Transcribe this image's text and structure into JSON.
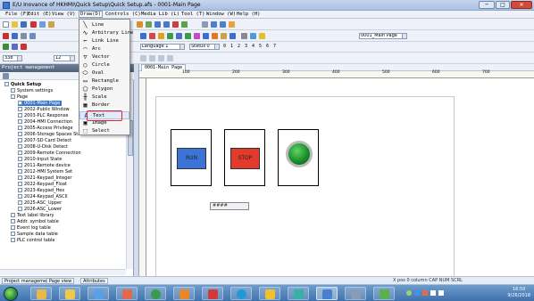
{
  "window": {
    "title": "E/U Inovance of HKHMI\\Quick Setup\\Quick Setup.afs - 0001-Main Page"
  },
  "window_buttons": {
    "minimize": "─",
    "maximize": "□",
    "close": "✕"
  },
  "menubar": [
    {
      "label": "File (F)",
      "key": "file"
    },
    {
      "label": "Edit (E)",
      "key": "edit"
    },
    {
      "label": "View (V)",
      "key": "view"
    },
    {
      "label": "Draw(D)",
      "key": "draw"
    },
    {
      "label": "Controls (C)",
      "key": "controls"
    },
    {
      "label": "Media Lib (L)",
      "key": "media"
    },
    {
      "label": "Tool (T)",
      "key": "tool"
    },
    {
      "label": "Window (W)",
      "key": "window"
    },
    {
      "label": "Help (H)",
      "key": "help"
    }
  ],
  "toolbar": {
    "page_combo": "0001_Main Page",
    "language_combo": "Language 1",
    "state_combo": "Status 0",
    "state_digits": [
      "0",
      "1",
      "2",
      "3",
      "4",
      "5",
      "6",
      "7"
    ],
    "zoom_combo": "338",
    "font_size": "12"
  },
  "left_panel": {
    "header": "Project management",
    "tree": [
      {
        "label": "Quick Setup",
        "bold": true
      },
      {
        "label": "System settings"
      },
      {
        "label": "Page"
      },
      {
        "label": "0001-Main Page",
        "selected": true
      },
      {
        "label": "2002-Public Window"
      },
      {
        "label": "2003-PLC Response"
      },
      {
        "label": "2004-HMI Connection"
      },
      {
        "label": "2005-Access Privilege"
      },
      {
        "label": "2006-Storage Spaces State"
      },
      {
        "label": "2007-SD Card Detect"
      },
      {
        "label": "2008-U-Disk Detect"
      },
      {
        "label": "2009-Remote Connection"
      },
      {
        "label": "2010-Input State"
      },
      {
        "label": "2011-Remote device"
      },
      {
        "label": "2012-HMI System Set"
      },
      {
        "label": "2021-Keypad_Integer"
      },
      {
        "label": "2022-Keypad_Float"
      },
      {
        "label": "2023-Keypad_Hex"
      },
      {
        "label": "2024-Keypad_ASCII"
      },
      {
        "label": "2025-ASC_Upper"
      },
      {
        "label": "2026-ASC_Lower"
      },
      {
        "label": "Text label library"
      },
      {
        "label": "Addr. symbol table"
      },
      {
        "label": "Event log table"
      },
      {
        "label": "Sample data table"
      },
      {
        "label": "PLC control table"
      }
    ]
  },
  "bottom_tabs": [
    "Project management",
    "Page view",
    "Attributes"
  ],
  "status_text": "X pos 0  column CAP NUM SCRL",
  "editor": {
    "tab_label": "0001-Main Page",
    "ruler": [
      "100",
      "200",
      "300",
      "400",
      "500",
      "600",
      "700"
    ]
  },
  "draw_menu": {
    "items": [
      {
        "label": "Line",
        "glyph": "╲"
      },
      {
        "label": "Arbitrary Line",
        "glyph": "∿"
      },
      {
        "label": "Link Line",
        "glyph": "⌐"
      },
      {
        "label": "Arc",
        "glyph": "◠"
      },
      {
        "label": "Vector",
        "glyph": "▽"
      },
      {
        "label": "Circle",
        "glyph": "○"
      },
      {
        "label": "Oval",
        "glyph": "⬭"
      },
      {
        "label": "Rectangle",
        "glyph": "▭"
      },
      {
        "label": "Polygon",
        "glyph": "⬠"
      },
      {
        "label": "Scale",
        "glyph": "╫"
      },
      {
        "label": "Border",
        "glyph": "▦"
      },
      {
        "label": "Text",
        "glyph": "A",
        "highlight": true
      },
      {
        "label": "Image",
        "glyph": "▣"
      },
      {
        "label": "Select",
        "glyph": "⬚"
      }
    ]
  },
  "canvas": {
    "buttons": [
      {
        "label": "RUN",
        "color": "#3b74d6"
      },
      {
        "label": "STOP",
        "color": "#e23b2e"
      },
      {
        "label": "",
        "color": "#1d8f2a"
      }
    ],
    "text_object": "####"
  },
  "taskbar": {
    "time": "16:50",
    "date": "9/26/2018"
  }
}
